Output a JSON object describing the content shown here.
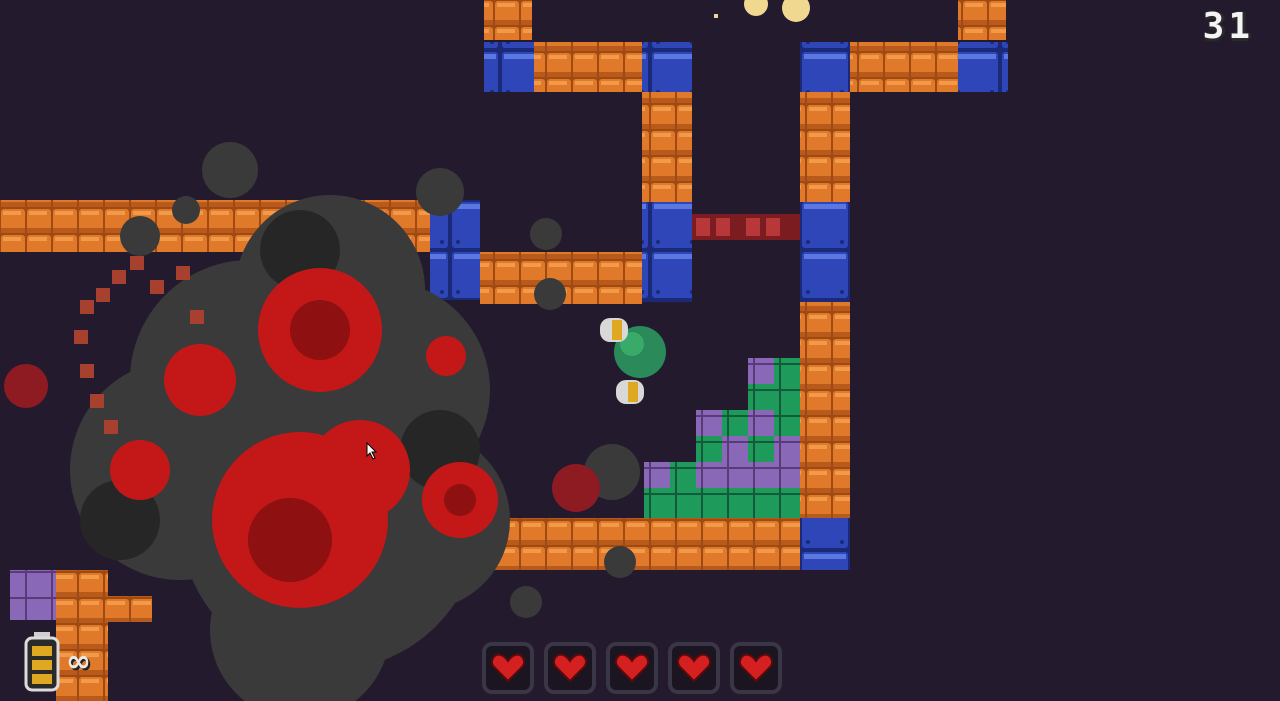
{
  "hud": {
    "score": "31",
    "lives": 5,
    "ammo": "∞",
    "heart_icon": "heart-icon",
    "ammo_icon": "battery-icon"
  },
  "colors": {
    "background": "#231a2e",
    "brick": "#e07a2a",
    "brick_shadow": "#9e4a12",
    "metal_block": "#2e46b8",
    "heart": "#d42020",
    "enemy_blood": "#c41818",
    "smoke": "#3a3a3a",
    "player": "#2a8a5a"
  }
}
